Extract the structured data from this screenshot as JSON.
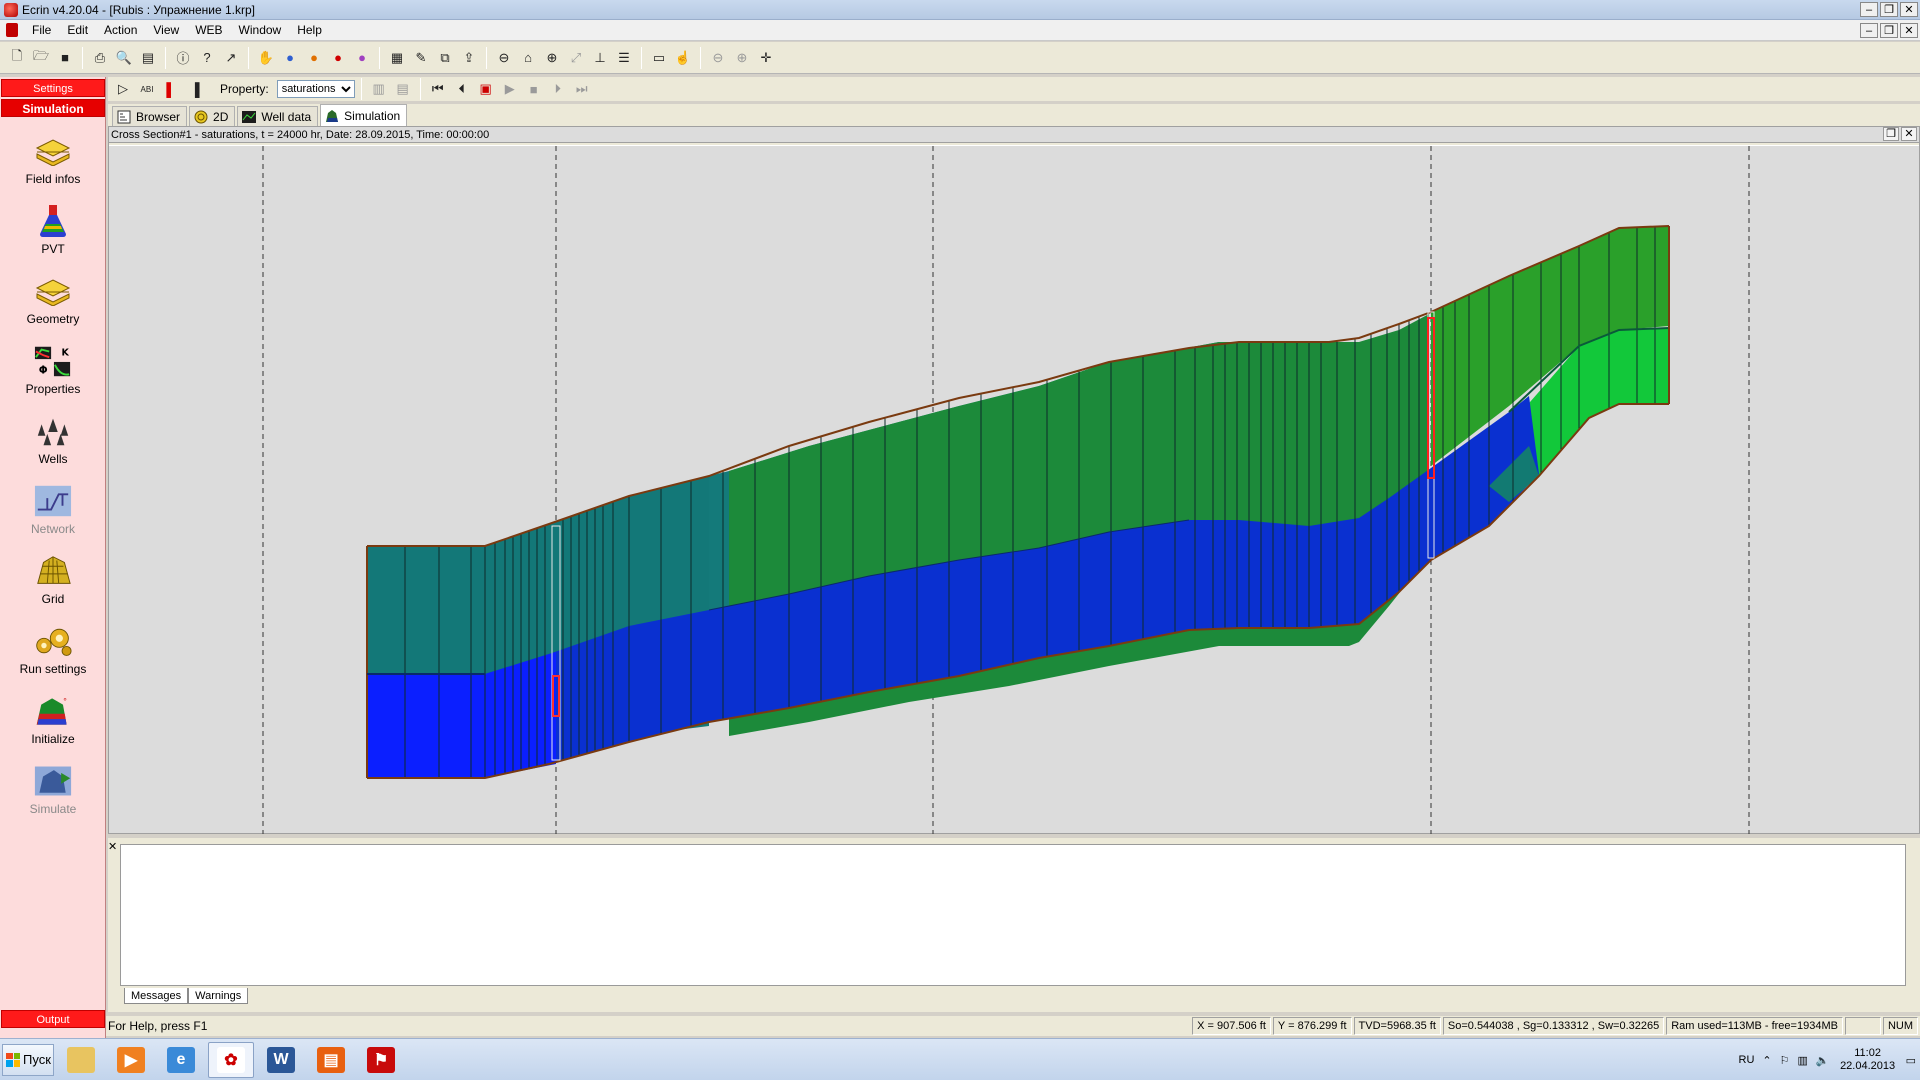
{
  "window": {
    "title": "Ecrin  v4.20.04 - [Rubis : Упражнение 1.krp]"
  },
  "menu": [
    "File",
    "Edit",
    "Action",
    "View",
    "WEB",
    "Window",
    "Help"
  ],
  "sidebar": {
    "settings_label": "Settings",
    "simulation_label": "Simulation",
    "output_label": "Output",
    "items": [
      {
        "label": "Field infos",
        "icon": "layers-icon",
        "enabled": true
      },
      {
        "label": "PVT",
        "icon": "flask-icon",
        "enabled": true
      },
      {
        "label": "Geometry",
        "icon": "layers-icon",
        "enabled": true
      },
      {
        "label": "Properties",
        "icon": "properties-chart-icon",
        "enabled": true
      },
      {
        "label": "Wells",
        "icon": "wells-icon",
        "enabled": true
      },
      {
        "label": "Network",
        "icon": "network-icon",
        "enabled": false
      },
      {
        "label": "Grid",
        "icon": "grid-icon",
        "enabled": true
      },
      {
        "label": "Run settings",
        "icon": "run-settings-icon",
        "enabled": true
      },
      {
        "label": "Initialize",
        "icon": "initialize-icon",
        "enabled": true
      },
      {
        "label": "Simulate",
        "icon": "simulate-icon",
        "enabled": false
      }
    ]
  },
  "toolbar2": {
    "property_label": "Property:",
    "property_value": "saturations",
    "property_options": [
      "saturations"
    ]
  },
  "tabs": [
    {
      "label": "Browser",
      "active": false
    },
    {
      "label": "2D",
      "active": false
    },
    {
      "label": "Well data",
      "active": false
    },
    {
      "label": "Simulation",
      "active": true
    }
  ],
  "document": {
    "title": "Cross Section#1 - saturations, t = 24000 hr, Date: 28.09.2015, Time: 00:00:00"
  },
  "output": {
    "tabs": [
      "Messages",
      "Warnings"
    ]
  },
  "status": {
    "help": "For Help, press F1",
    "x": "X = 907.506 ft",
    "y": "Y = 876.299 ft",
    "tvd": "TVD=5968.35 ft",
    "sats": "So=0.544038 , Sg=0.133312 , Sw=0.32265",
    "ram": "Ram used=113MB - free=1934MB",
    "num": "NUM"
  },
  "taskbar": {
    "start_label": "Пуск",
    "lang": "RU",
    "time": "11:02",
    "date": "22.04.2013"
  },
  "colors": {
    "gas": "#2aa12a",
    "oil_gas_zone": "#1a8a4a",
    "oil": "#147a7a",
    "water": "#0a2fd0",
    "sidebar_bg": "#fddcdc",
    "sidebar_header": "#ff1a1a"
  }
}
